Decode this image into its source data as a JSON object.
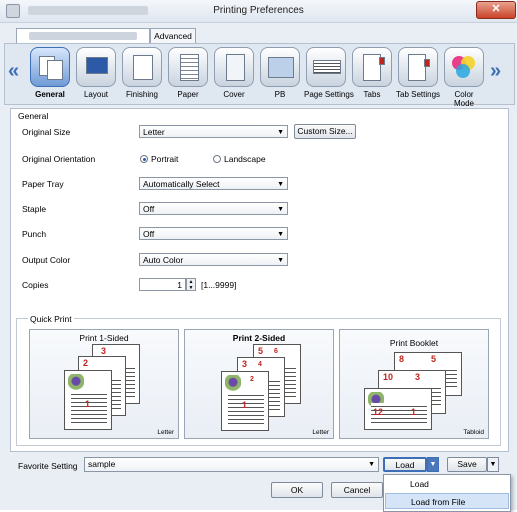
{
  "window": {
    "title": "Printing Preferences",
    "close_glyph": "✕"
  },
  "tabs": [
    {
      "label": ""
    },
    {
      "label": "Advanced"
    }
  ],
  "ribbon": {
    "items": [
      {
        "label": "General",
        "icon": "general-icon",
        "active": true
      },
      {
        "label": "Layout",
        "icon": "layout-icon"
      },
      {
        "label": "Finishing",
        "icon": "finishing-icon"
      },
      {
        "label": "Paper",
        "icon": "paper-icon"
      },
      {
        "label": "Cover",
        "icon": "cover-icon"
      },
      {
        "label": "PB",
        "icon": "pb-icon"
      },
      {
        "label": "Page Settings",
        "icon": "page-settings-icon"
      },
      {
        "label": "Tabs",
        "icon": "tabs-icon"
      },
      {
        "label": "Tab Settings",
        "icon": "tab-settings-icon"
      },
      {
        "label": "Color\nMode",
        "icon": "color-mode-icon"
      }
    ],
    "left_arrow": "«",
    "right_arrow": "»"
  },
  "general": {
    "section_label": "General",
    "original_size": {
      "label": "Original Size",
      "value": "Letter",
      "button": "Custom Size..."
    },
    "orientation": {
      "label": "Original Orientation",
      "portrait": "Portrait",
      "landscape": "Landscape",
      "selected": "Portrait"
    },
    "paper_tray": {
      "label": "Paper Tray",
      "value": "Automatically Select"
    },
    "staple": {
      "label": "Staple",
      "value": "Off"
    },
    "punch": {
      "label": "Punch",
      "value": "Off"
    },
    "output_color": {
      "label": "Output Color",
      "value": "Auto Color"
    },
    "copies": {
      "label": "Copies",
      "value": "1",
      "range": "[1...9999]"
    }
  },
  "quick_print": {
    "label": "Quick Print",
    "cards": [
      {
        "title": "Print 1-Sided",
        "size": "Letter",
        "bold": false,
        "numbers": [
          "3",
          "2",
          "1"
        ]
      },
      {
        "title": "Print 2-Sided",
        "size": "Letter",
        "bold": true,
        "numbers": [
          "5",
          "6",
          "3",
          "4",
          "1",
          "2"
        ]
      },
      {
        "title": "Print Booklet",
        "size": "Tabloid",
        "bold": false,
        "numbers": [
          "8",
          "5",
          "10",
          "3",
          "12",
          "1"
        ]
      }
    ]
  },
  "favorite": {
    "label": "Favorite Setting",
    "value": "sample"
  },
  "buttons": {
    "load": "Load",
    "save": "Save",
    "ok": "OK",
    "cancel": "Cancel"
  },
  "load_menu": {
    "items": [
      "Load",
      "Load from File"
    ]
  },
  "colors": {
    "accent": "#3d6fb7",
    "highlight": "#d5e4f6",
    "page_number": "#c0241f"
  }
}
